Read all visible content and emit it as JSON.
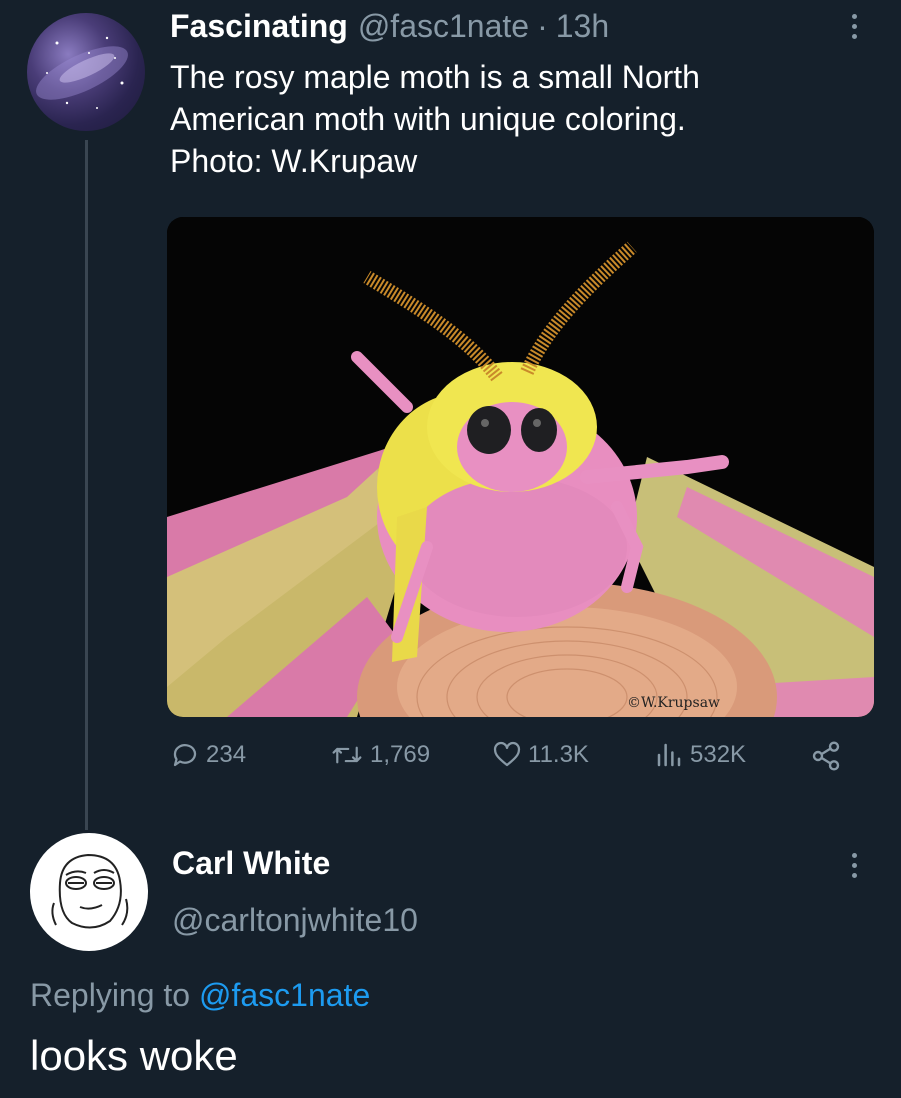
{
  "original_tweet": {
    "display_name": "Fascinating",
    "handle": "@fasc1nate",
    "separator": "·",
    "time": "13h",
    "text_lines": [
      "The rosy maple moth is a small North",
      "American moth with unique coloring.",
      "Photo: W.Krupaw"
    ],
    "media": {
      "watermark": "©W.Krupsaw"
    },
    "stats": {
      "replies": "234",
      "retweets": "1,769",
      "likes": "11.3K",
      "views": "532K"
    }
  },
  "reply": {
    "display_name": "Carl White",
    "handle": "@carltonjwhite10",
    "replying_prefix": "Replying to",
    "replying_to": "@fasc1nate",
    "text": "looks woke"
  },
  "icons": {
    "reply": "speech-bubble-icon",
    "retweet": "retweet-icon",
    "like": "heart-icon",
    "views": "bar-chart-icon",
    "share": "share-icon",
    "more": "kebab-icon"
  },
  "colors": {
    "background": "#15202b",
    "muted": "#8899a6",
    "link": "#1d9bf0",
    "thread_line": "#3a4652"
  }
}
